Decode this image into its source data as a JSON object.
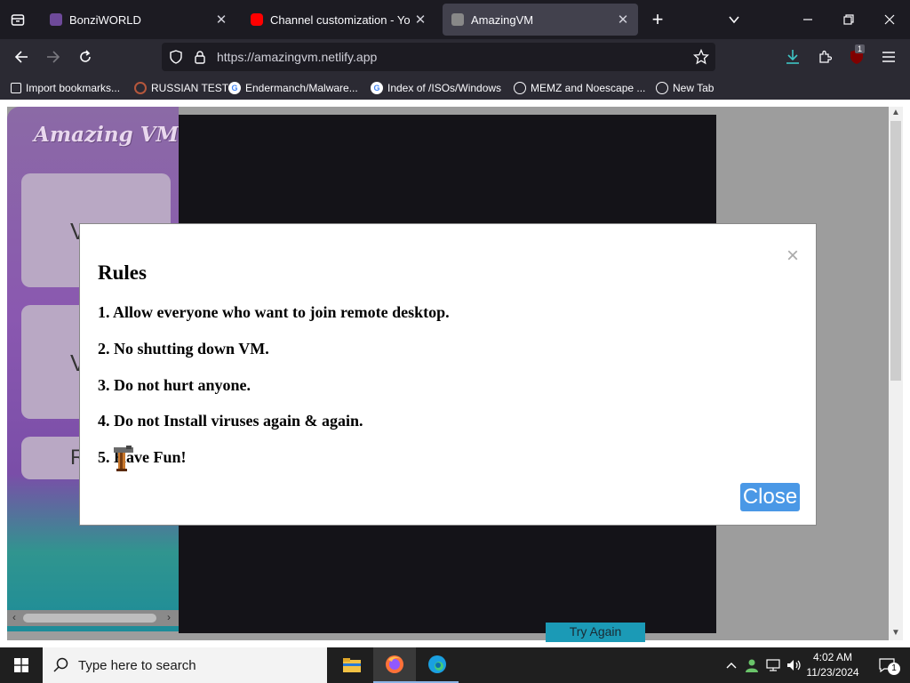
{
  "browser": {
    "tabs": [
      {
        "title": "BonziWORLD",
        "active": false
      },
      {
        "title": "Channel customization - YouTube",
        "active": false
      },
      {
        "title": "AmazingVM",
        "active": true
      }
    ],
    "url": "https://amazingvm.netlify.app",
    "download_badge": "1",
    "bookmarks": [
      {
        "label": "Import bookmarks...",
        "icon": "import-icon"
      },
      {
        "label": "RUSSIAN TEST",
        "icon": "site-icon"
      },
      {
        "label": "Endermanch/Malware...",
        "icon": "google-icon"
      },
      {
        "label": "Index of /ISOs/Windows",
        "icon": "google-icon"
      },
      {
        "label": "MEMZ and Noescape ...",
        "icon": "globe-icon"
      },
      {
        "label": "New Tab",
        "icon": "globe-icon"
      }
    ]
  },
  "page": {
    "logo_text": "Amazing VM",
    "sidebar_cards": [
      "V",
      "V",
      "R"
    ],
    "try_again_label": "Try Again"
  },
  "modal": {
    "title": "Rules",
    "rules": [
      "1. Allow everyone who want to join remote desktop.",
      "2. No shutting down VM.",
      "3. Do not hurt anyone.",
      "4. Do not Install viruses again & again.",
      "5. Have Fun!"
    ],
    "close_symbol": "×",
    "close_label": "Close"
  },
  "taskbar": {
    "search_placeholder": "Type here to search",
    "time": "4:02 AM",
    "date": "11/23/2024",
    "notification_count": "1"
  },
  "colors": {
    "accent_close": "#4a98e6",
    "try_again": "#1b9ab6",
    "tab_active": "#42414d"
  }
}
